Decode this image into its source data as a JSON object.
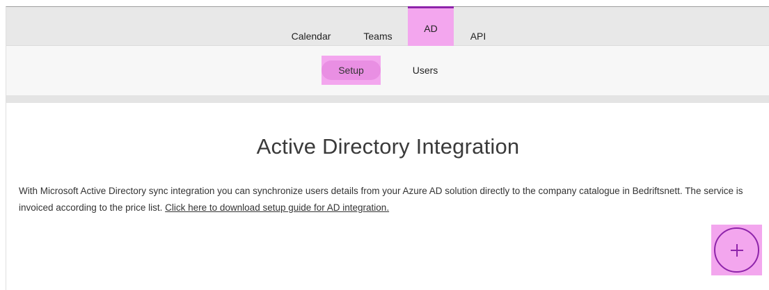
{
  "nav": {
    "tabs": [
      {
        "label": "Calendar"
      },
      {
        "label": "Teams"
      },
      {
        "label": "AD"
      },
      {
        "label": "API"
      }
    ],
    "active_tab": "AD",
    "sub_tabs": [
      {
        "label": "Setup"
      },
      {
        "label": "Users"
      }
    ],
    "active_sub_tab": "Setup"
  },
  "main": {
    "title": "Active Directory Integration",
    "description": "With Microsoft Active Directory sync integration you can synchronize users details from your Azure AD solution directly to the company catalogue in Bedriftsnett. The service is invoiced according to the price list.",
    "guide_link": "Click here to download setup guide for AD integration.",
    "add_icon": "plus-icon"
  },
  "colors": {
    "highlight": "#f3a6ee",
    "accent": "#8e24aa",
    "nav_bg": "#e8e8e8",
    "subnav_bg": "#f7f7f7"
  }
}
